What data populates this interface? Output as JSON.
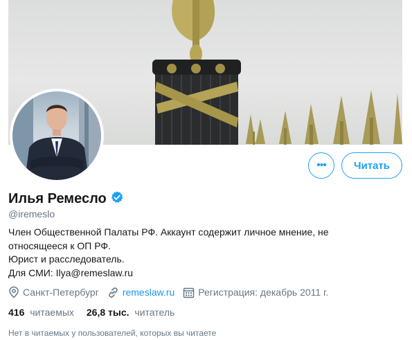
{
  "profile": {
    "name": "Илья Ремесло",
    "handle": "@iremeslo",
    "bio_lines": [
      "Член Общественной Палаты РФ. Аккаунт содержит личное мнение, не",
      "относящееся к ОП РФ.",
      "Юрист и расследователь.",
      "Для СМИ: Ilya@remeslaw.ru"
    ],
    "location": "Санкт-Петербург",
    "website": "remeslaw.ru",
    "joined": "Регистрация: декабрь 2011 г."
  },
  "actions": {
    "more_label": "•••",
    "follow_label": "Читать"
  },
  "stats": {
    "following_count": "416",
    "following_label": "читаемых",
    "followers_count": "26,8 тыс.",
    "followers_label": "читатель"
  },
  "mutuals_note": "Нет в читаемых у пользователей, которых вы читаете",
  "colors": {
    "accent": "#1da1f2",
    "link": "#1b95e0",
    "secondary_text": "#657786",
    "primary_text": "#14171a"
  }
}
